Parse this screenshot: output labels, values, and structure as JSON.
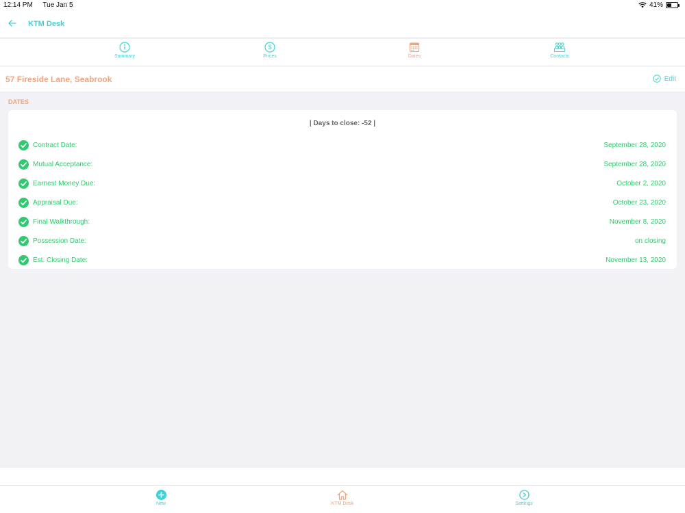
{
  "status": {
    "time": "12:14 PM",
    "date": "Tue Jan 5",
    "battery": "41%",
    "battery_level": 0.41
  },
  "nav": {
    "title": "KTM Desk"
  },
  "tabs": [
    {
      "label": "Summary",
      "icon": "info-icon",
      "active": false
    },
    {
      "label": "Prices",
      "icon": "dollar-icon",
      "active": false
    },
    {
      "label": "Dates",
      "icon": "calendar-icon",
      "active": true
    },
    {
      "label": "Contacts",
      "icon": "contacts-icon",
      "active": false
    }
  ],
  "property": {
    "address": "57 Fireside Lane, Seabrook",
    "edit_label": "Edit"
  },
  "dates": {
    "section_title": "DATES",
    "days_to_close": "| Days to close: -52 |",
    "rows": [
      {
        "label": "Contract Date:",
        "value": "September 28, 2020"
      },
      {
        "label": "Mutual Acceptance:",
        "value": "September 28, 2020"
      },
      {
        "label": "Earnest Money Due:",
        "value": "October 2, 2020"
      },
      {
        "label": "Appraisal Due:",
        "value": "October 23, 2020"
      },
      {
        "label": "Final Walkthrough:",
        "value": "November 8, 2020"
      },
      {
        "label": "Possession Date:",
        "value": "on closing"
      },
      {
        "label": "Est. Closing Date:",
        "value": "November 13, 2020"
      }
    ]
  },
  "bottom_tabs": [
    {
      "label": "New",
      "icon": "plus-circle-icon",
      "active": false
    },
    {
      "label": "KTM Desk",
      "icon": "home-icon",
      "active": true
    },
    {
      "label": "Settings",
      "icon": "settings-icon",
      "active": false
    }
  ],
  "colors": {
    "teal": "#3fd1d3",
    "orange": "#f0a47e",
    "green": "#2fc96e"
  }
}
